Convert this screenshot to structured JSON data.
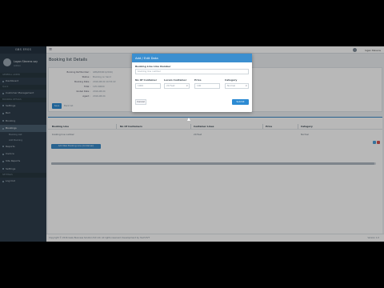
{
  "sidebar": {
    "brand": "GBS ERSS",
    "user_name": "Logan Stevens say",
    "user_role": "Admin",
    "items": [
      {
        "type": "section",
        "label": "GENERAL ADMIN"
      },
      {
        "type": "item",
        "label": "Dashboard"
      },
      {
        "type": "section",
        "label": "Quick"
      },
      {
        "type": "item",
        "label": "Customer Management"
      },
      {
        "type": "section",
        "label": "BOOKING DETAILS"
      },
      {
        "type": "item",
        "label": "Settings"
      },
      {
        "type": "item",
        "label": "Bell"
      },
      {
        "type": "item",
        "label": "Booking"
      },
      {
        "type": "item",
        "label": "Bookings",
        "active": true
      },
      {
        "type": "sub",
        "label": "Booking List"
      },
      {
        "type": "sub",
        "label": "Add Booking"
      },
      {
        "type": "item",
        "label": "Reports"
      },
      {
        "type": "item",
        "label": "Invoice"
      },
      {
        "type": "item",
        "label": "Site Reports"
      },
      {
        "type": "item",
        "label": "Settings"
      },
      {
        "type": "section",
        "label": "SETTINGS"
      },
      {
        "type": "item",
        "label": "Log Out"
      }
    ]
  },
  "topbar": {
    "user": "logan Stevens"
  },
  "page": {
    "title": "Booking list Details"
  },
  "details": [
    {
      "k": "Booking Ref Number :",
      "v": "GBS/08/001(2016)"
    },
    {
      "k": "Status :",
      "v": "Booking on hand"
    },
    {
      "k": "Booking Date :",
      "v": "2016-08-04 10:53:22"
    },
    {
      "k": "Total :",
      "v": "125.00000"
    },
    {
      "k": "Global Date :",
      "v": "2016-08-04"
    },
    {
      "k": "Agent :",
      "v": "2016-08-04"
    }
  ],
  "details_buttons": {
    "save": "Save",
    "back": "Back list"
  },
  "table": {
    "headers": [
      "Booking Line",
      "No Of Containers",
      "Container Lines",
      "Price",
      "Category"
    ],
    "rows": [
      {
        "booking_line": "booking line number",
        "containers": "",
        "container_lines": "20 Feet",
        "price": "",
        "category": "Normal"
      }
    ],
    "add_button": "Add New Booking Line (Container)"
  },
  "footer": {
    "left": "Copyright © 2016 Gaze Business Solution Pvt Ltd. All rights reserved. Development by YouPi PVT",
    "right": "Version 1.0"
  },
  "modal": {
    "title": "Add / Edit Data",
    "booking_line_label": "Booking Line Line Number",
    "booking_line_placeholder": "booking line number",
    "containers_label": "No Of Container",
    "containers_value": "1000",
    "container_type_label": "Lorem Container",
    "container_type_value": "20 Feet",
    "price_label": "Price",
    "price_value": "100",
    "category_label": "Category",
    "category_value": "Normal",
    "cancel": "Cancel",
    "submit": "Submit"
  },
  "colors": {
    "accent": "#2d8bd3",
    "sidebar_bg": "#2f3e4c"
  }
}
